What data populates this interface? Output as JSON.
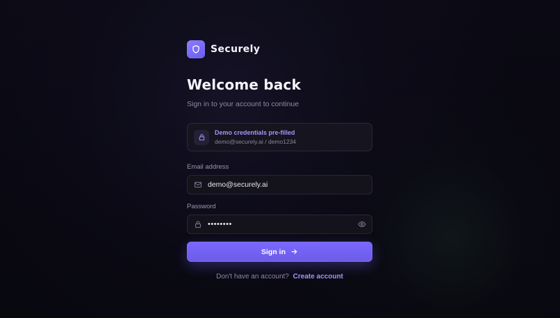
{
  "brand": {
    "name": "Securely",
    "accent": "#7a68ff"
  },
  "heading": {
    "title": "Welcome back",
    "subtitle": "Sign in to your account to continue"
  },
  "demo": {
    "title": "Demo credentials pre-filled",
    "credentials": "demo@securely.ai / demo1234",
    "icon": "lock-icon"
  },
  "form": {
    "email": {
      "label": "Email address",
      "value": "demo@securely.ai",
      "icon": "mail-icon"
    },
    "password": {
      "label": "Password",
      "value": "demo1234",
      "icon": "lock-icon",
      "toggle_icon": "eye-icon"
    },
    "submit": {
      "label": "Sign in",
      "icon": "arrow-right-icon"
    }
  },
  "footer": {
    "text": "Don't have an account?",
    "link": "Create account"
  }
}
